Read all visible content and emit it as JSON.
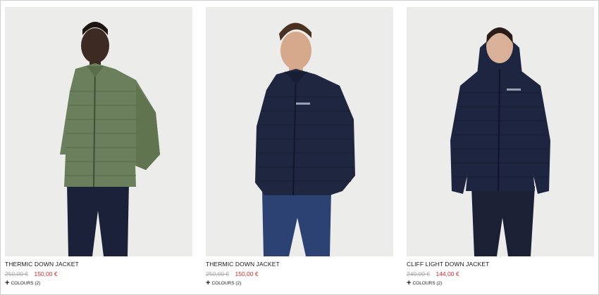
{
  "products": [
    {
      "name": "THERMIC DOWN JACKET",
      "old_price": "250,00 €",
      "new_price": "150,00 €",
      "plus_icon": "+",
      "colours": "COLOURS (2)",
      "jacket_color": "#6a7f5b"
    },
    {
      "name": "THERMIC DOWN JACKET",
      "old_price": "250,00 €",
      "new_price": "150,00 €",
      "plus_icon": "+",
      "colours": "COLOURS (2)",
      "jacket_color": "#1f2740"
    },
    {
      "name": "CLIFF LIGHT DOWN JACKET",
      "old_price": "240,00 €",
      "new_price": "144,00 €",
      "plus_icon": "+",
      "colours": "COLOURS (2)",
      "jacket_color": "#1d2540"
    }
  ],
  "colors": {
    "sale_red": "#e0262a",
    "strike_grey": "#a8a8a8",
    "photo_bg": "#ececeb"
  }
}
